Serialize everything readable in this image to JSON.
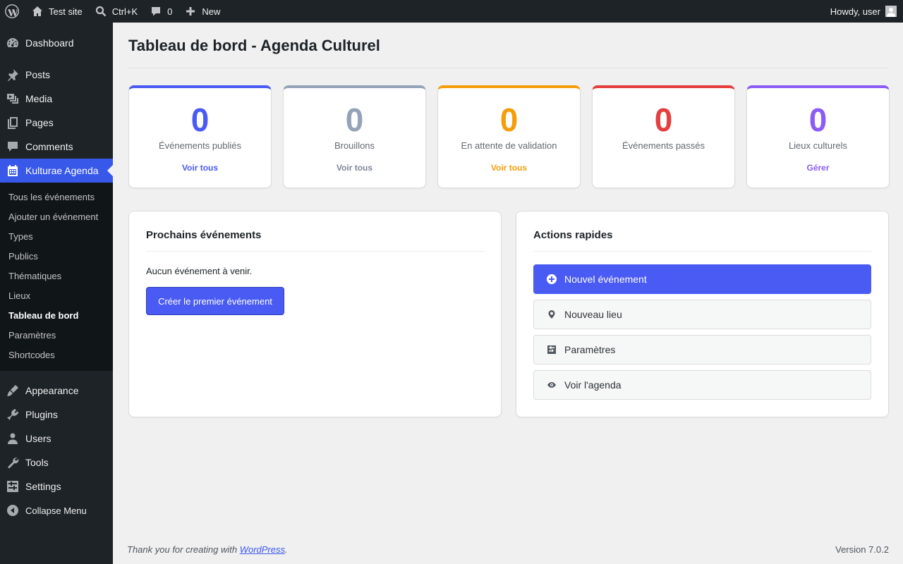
{
  "adminbar": {
    "site_name": "Test site",
    "search_shortcut": "Ctrl+K",
    "comments_count": "0",
    "new_label": "New",
    "howdy": "Howdy, user"
  },
  "sidebar": {
    "items_top": [
      {
        "label": "Dashboard",
        "icon": "dashboard-icon"
      },
      {
        "label": "Posts",
        "icon": "pin-icon"
      },
      {
        "label": "Media",
        "icon": "media-icon"
      },
      {
        "label": "Pages",
        "icon": "pages-icon"
      },
      {
        "label": "Comments",
        "icon": "comment-icon"
      },
      {
        "label": "Kulturae Agenda",
        "icon": "calendar-icon"
      }
    ],
    "submenu": [
      "Tous les événements",
      "Ajouter un événement",
      "Types",
      "Publics",
      "Thématiques",
      "Lieux",
      "Tableau de bord",
      "Paramètres",
      "Shortcodes"
    ],
    "items_bottom": [
      {
        "label": "Appearance",
        "icon": "brush-icon"
      },
      {
        "label": "Plugins",
        "icon": "plugin-icon"
      },
      {
        "label": "Users",
        "icon": "user-icon"
      },
      {
        "label": "Tools",
        "icon": "wrench-icon"
      },
      {
        "label": "Settings",
        "icon": "settings-icon"
      }
    ],
    "collapse": "Collapse Menu"
  },
  "main": {
    "title": "Tableau de bord - Agenda Culturel",
    "stats": [
      {
        "value": "0",
        "label": "Événements publiés",
        "link": "Voir tous",
        "color": "#4a5bf4"
      },
      {
        "value": "0",
        "label": "Brouillons",
        "link": "Voir tous",
        "color": "#94a3b8"
      },
      {
        "value": "0",
        "label": "En attente de validation",
        "link": "Voir tous",
        "color": "#f59e0b"
      },
      {
        "value": "0",
        "label": "Événements passés",
        "link": "",
        "color": "#e53e3e"
      },
      {
        "value": "0",
        "label": "Lieux culturels",
        "link": "Gérer",
        "color": "#8b5cf6"
      }
    ],
    "upcoming": {
      "title": "Prochains événements",
      "empty": "Aucun événement à venir.",
      "button": "Créer le premier événement"
    },
    "actions": {
      "title": "Actions rapides",
      "items": [
        {
          "label": "Nouvel événement",
          "icon": "plus-circle-icon"
        },
        {
          "label": "Nouveau lieu",
          "icon": "location-icon"
        },
        {
          "label": "Paramètres",
          "icon": "settings-icon"
        },
        {
          "label": "Voir l'agenda",
          "icon": "eye-icon"
        }
      ]
    }
  },
  "footer": {
    "thanks_prefix": "Thank you for creating with ",
    "thanks_link": "WordPress",
    "thanks_suffix": ".",
    "version": "Version 7.0.2"
  },
  "colors": {
    "accent": "#4a5bf4",
    "admin_dark": "#1d2327"
  }
}
